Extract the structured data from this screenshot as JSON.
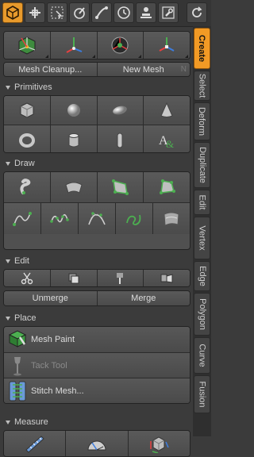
{
  "toolbar": {
    "buttons": [
      {
        "icon": "mesh-cube-icon"
      },
      {
        "icon": "move-all-icon"
      },
      {
        "icon": "select-region-icon"
      },
      {
        "icon": "brush-paint-icon"
      },
      {
        "icon": "tube-path-icon"
      },
      {
        "icon": "clock-icon"
      },
      {
        "icon": "user-stamp-icon"
      },
      {
        "icon": "wrench-icon"
      },
      {
        "icon": "refresh-icon"
      }
    ]
  },
  "side_tabs": [
    "Create",
    "Select",
    "Deform",
    "Duplicate",
    "Edit",
    "Vertex",
    "Edge",
    "Polygon",
    "Curve",
    "Fusion"
  ],
  "mesh_ops": {
    "cleanup_label": "Mesh Cleanup...",
    "new_mesh_label": "New Mesh",
    "shortcut": "N"
  },
  "sections": {
    "primitives": "Primitives",
    "draw": "Draw",
    "edit": "Edit",
    "place": "Place",
    "measure": "Measure"
  },
  "edit": {
    "unmerge_label": "Unmerge",
    "merge_label": "Merge"
  },
  "place": {
    "mesh_paint": "Mesh Paint",
    "tack_tool": "Tack Tool",
    "stitch_mesh": "Stitch Mesh..."
  },
  "colors": {
    "accent": "#f29a25",
    "panel": "#3b3b3b"
  }
}
